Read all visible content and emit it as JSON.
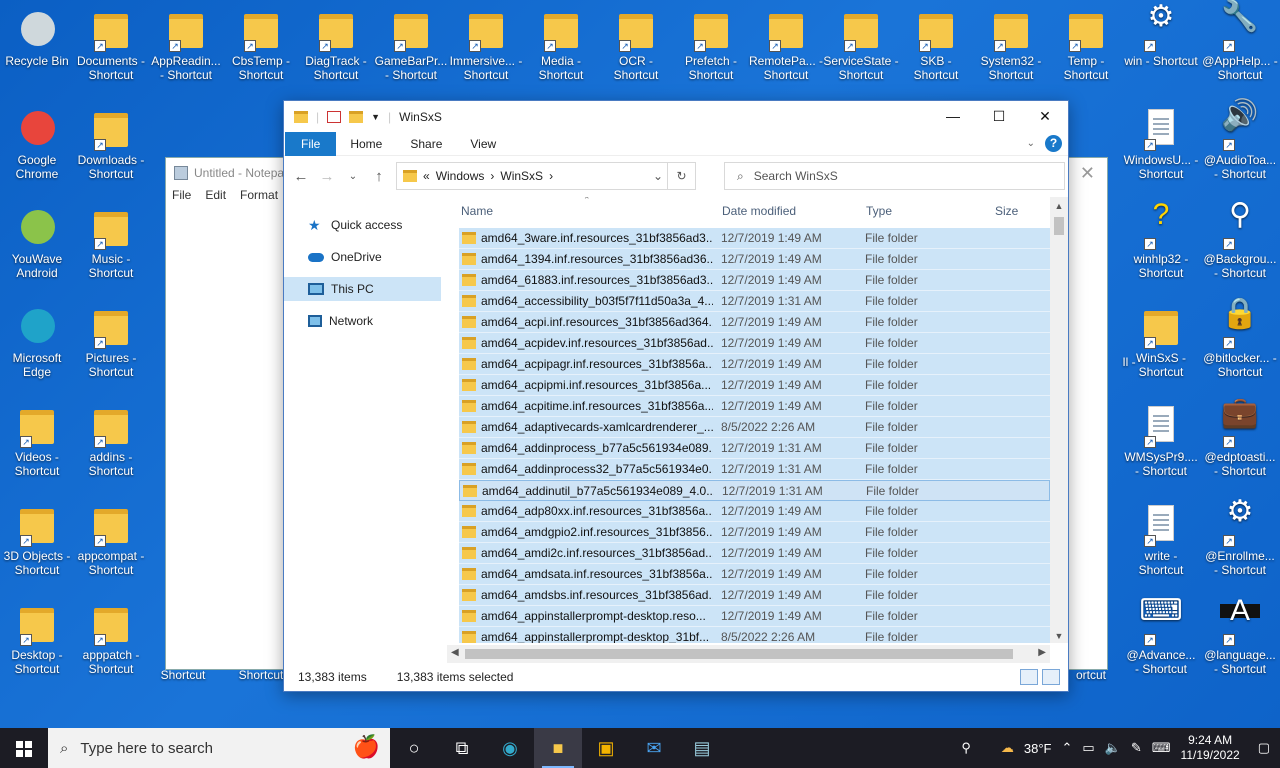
{
  "desktop": {
    "icons_left": [
      {
        "label": "Recycle Bin",
        "icon": "recycle-bin-icon"
      },
      {
        "label": "Google Chrome",
        "icon": "chrome-icon"
      },
      {
        "label": "YouWave Android",
        "icon": "android-icon"
      },
      {
        "label": "Microsoft Edge",
        "icon": "edge-icon"
      },
      {
        "label": "Videos - Shortcut",
        "icon": "videos-folder-icon"
      },
      {
        "label": "3D Objects - Shortcut",
        "icon": "folder-icon"
      },
      {
        "label": "Desktop - Shortcut",
        "icon": "folder-icon"
      }
    ],
    "icons_col2": [
      {
        "label": "Documents - Shortcut",
        "icon": "documents-folder-icon"
      },
      {
        "label": "Downloads - Shortcut",
        "icon": "downloads-folder-icon"
      },
      {
        "label": "Music - Shortcut",
        "icon": "music-folder-icon"
      },
      {
        "label": "Pictures - Shortcut",
        "icon": "pictures-folder-icon"
      },
      {
        "label": "addins - Shortcut",
        "icon": "folder-icon"
      },
      {
        "label": "appcompat - Shortcut",
        "icon": "folder-icon"
      },
      {
        "label": "apppatch - Shortcut",
        "icon": "folder-icon"
      }
    ],
    "icons_top": [
      {
        "label": "AppReadin... - Shortcut"
      },
      {
        "label": "CbsTemp - Shortcut"
      },
      {
        "label": "DiagTrack - Shortcut"
      },
      {
        "label": "GameBarPr... - Shortcut"
      },
      {
        "label": "Immersive... - Shortcut"
      },
      {
        "label": "Media - Shortcut"
      },
      {
        "label": "OCR - Shortcut"
      },
      {
        "label": "Prefetch - Shortcut"
      },
      {
        "label": "RemotePa... - Shortcut"
      },
      {
        "label": "ServiceState - Shortcut"
      },
      {
        "label": "SKB - Shortcut"
      },
      {
        "label": "System32 - Shortcut"
      },
      {
        "label": "Temp - Shortcut"
      }
    ],
    "icons_right1": [
      {
        "label": "win - Shortcut",
        "icon": "gear-icon"
      },
      {
        "label": "WindowsU... - Shortcut",
        "icon": "document-icon"
      },
      {
        "label": "winhlp32 - Shortcut",
        "icon": "help-icon"
      },
      {
        "label": "WinSxS - Shortcut",
        "icon": "folder-icon"
      },
      {
        "label": "WMSysPr9.... - Shortcut",
        "icon": "document-icon"
      },
      {
        "label": "write - Shortcut",
        "icon": "write-icon"
      },
      {
        "label": "@Advance... - Shortcut",
        "icon": "keyboard-icon"
      }
    ],
    "icons_right2": [
      {
        "label": "@AppHelp... - Shortcut",
        "icon": "wrench-icon"
      },
      {
        "label": "@AudioToa... - Shortcut",
        "icon": "speaker-icon"
      },
      {
        "label": "@Backgrou... - Shortcut",
        "icon": "pin-icon"
      },
      {
        "label": "@bitlocker... - Shortcut",
        "icon": "lock-icon"
      },
      {
        "label": "@edptoasti... - Shortcut",
        "icon": "briefcase-icon"
      },
      {
        "label": "@Enrollme... - Shortcut",
        "icon": "gear-icon"
      },
      {
        "label": "@language... - Shortcut",
        "icon": "language-icon"
      }
    ],
    "partial_labels": [
      "Shortcut",
      "Shortcut",
      "ortcut",
      "Il -"
    ]
  },
  "notepad": {
    "title": "Untitled - Notepad",
    "menu": [
      "File",
      "Edit",
      "Format"
    ]
  },
  "explorer": {
    "title": "WinSxS",
    "ribbon_tabs": [
      "File",
      "Home",
      "Share",
      "View"
    ],
    "breadcrumb": {
      "prefix": "«",
      "parts": [
        "Windows",
        "WinSxS"
      ]
    },
    "search_placeholder": "Search WinSxS",
    "nav": [
      "Quick access",
      "OneDrive",
      "This PC",
      "Network"
    ],
    "columns": [
      "Name",
      "Date modified",
      "Type",
      "Size"
    ],
    "rows": [
      {
        "name": "amd64_3ware.inf.resources_31bf3856ad3...",
        "date": "12/7/2019 1:49 AM",
        "type": "File folder"
      },
      {
        "name": "amd64_1394.inf.resources_31bf3856ad36...",
        "date": "12/7/2019 1:49 AM",
        "type": "File folder"
      },
      {
        "name": "amd64_61883.inf.resources_31bf3856ad3...",
        "date": "12/7/2019 1:49 AM",
        "type": "File folder"
      },
      {
        "name": "amd64_accessibility_b03f5f7f11d50a3a_4....",
        "date": "12/7/2019 1:31 AM",
        "type": "File folder"
      },
      {
        "name": "amd64_acpi.inf.resources_31bf3856ad364...",
        "date": "12/7/2019 1:49 AM",
        "type": "File folder"
      },
      {
        "name": "amd64_acpidev.inf.resources_31bf3856ad...",
        "date": "12/7/2019 1:49 AM",
        "type": "File folder"
      },
      {
        "name": "amd64_acpipagr.inf.resources_31bf3856a...",
        "date": "12/7/2019 1:49 AM",
        "type": "File folder"
      },
      {
        "name": "amd64_acpipmi.inf.resources_31bf3856a...",
        "date": "12/7/2019 1:49 AM",
        "type": "File folder"
      },
      {
        "name": "amd64_acpitime.inf.resources_31bf3856a...",
        "date": "12/7/2019 1:49 AM",
        "type": "File folder"
      },
      {
        "name": "amd64_adaptivecards-xamlcardrenderer_...",
        "date": "8/5/2022 2:26 AM",
        "type": "File folder"
      },
      {
        "name": "amd64_addinprocess_b77a5c561934e089...",
        "date": "12/7/2019 1:31 AM",
        "type": "File folder"
      },
      {
        "name": "amd64_addinprocess32_b77a5c561934e0...",
        "date": "12/7/2019 1:31 AM",
        "type": "File folder"
      },
      {
        "name": "amd64_addinutil_b77a5c561934e089_4.0...",
        "date": "12/7/2019 1:31 AM",
        "type": "File folder"
      },
      {
        "name": "amd64_adp80xx.inf.resources_31bf3856a...",
        "date": "12/7/2019 1:49 AM",
        "type": "File folder"
      },
      {
        "name": "amd64_amdgpio2.inf.resources_31bf3856...",
        "date": "12/7/2019 1:49 AM",
        "type": "File folder"
      },
      {
        "name": "amd64_amdi2c.inf.resources_31bf3856ad...",
        "date": "12/7/2019 1:49 AM",
        "type": "File folder"
      },
      {
        "name": "amd64_amdsata.inf.resources_31bf3856a...",
        "date": "12/7/2019 1:49 AM",
        "type": "File folder"
      },
      {
        "name": "amd64_amdsbs.inf.resources_31bf3856ad...",
        "date": "12/7/2019 1:49 AM",
        "type": "File folder"
      },
      {
        "name": "amd64_appinstallerprompt-desktop.reso...",
        "date": "12/7/2019 1:49 AM",
        "type": "File folder"
      },
      {
        "name": "amd64_appinstallerprompt-desktop_31bf...",
        "date": "8/5/2022 2:26 AM",
        "type": "File folder"
      }
    ],
    "status": {
      "count": "13,383 items",
      "selected": "13,383 items selected"
    }
  },
  "taskbar": {
    "search_placeholder": "Type here to search",
    "weather": "38°F",
    "time": "9:24 AM",
    "date": "11/19/2022"
  }
}
